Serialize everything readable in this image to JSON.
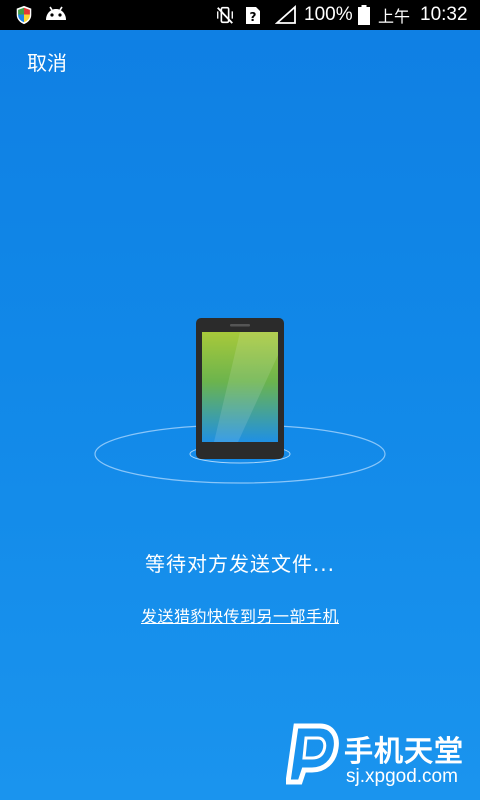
{
  "status_bar": {
    "battery_text": "100%",
    "time_period": "上午",
    "time": "10:32"
  },
  "header": {
    "cancel_label": "取消"
  },
  "main": {
    "status_message": "等待对方发送文件...",
    "share_link": "发送猎豹快传到另一部手机"
  },
  "watermark": {
    "title": "手机天堂",
    "site": "sj.xpgod.com"
  },
  "colors": {
    "background": "#1188e8",
    "status_bar": "#000000",
    "screen_top": "#a6c63a",
    "screen_bottom": "#1e8fe6"
  }
}
